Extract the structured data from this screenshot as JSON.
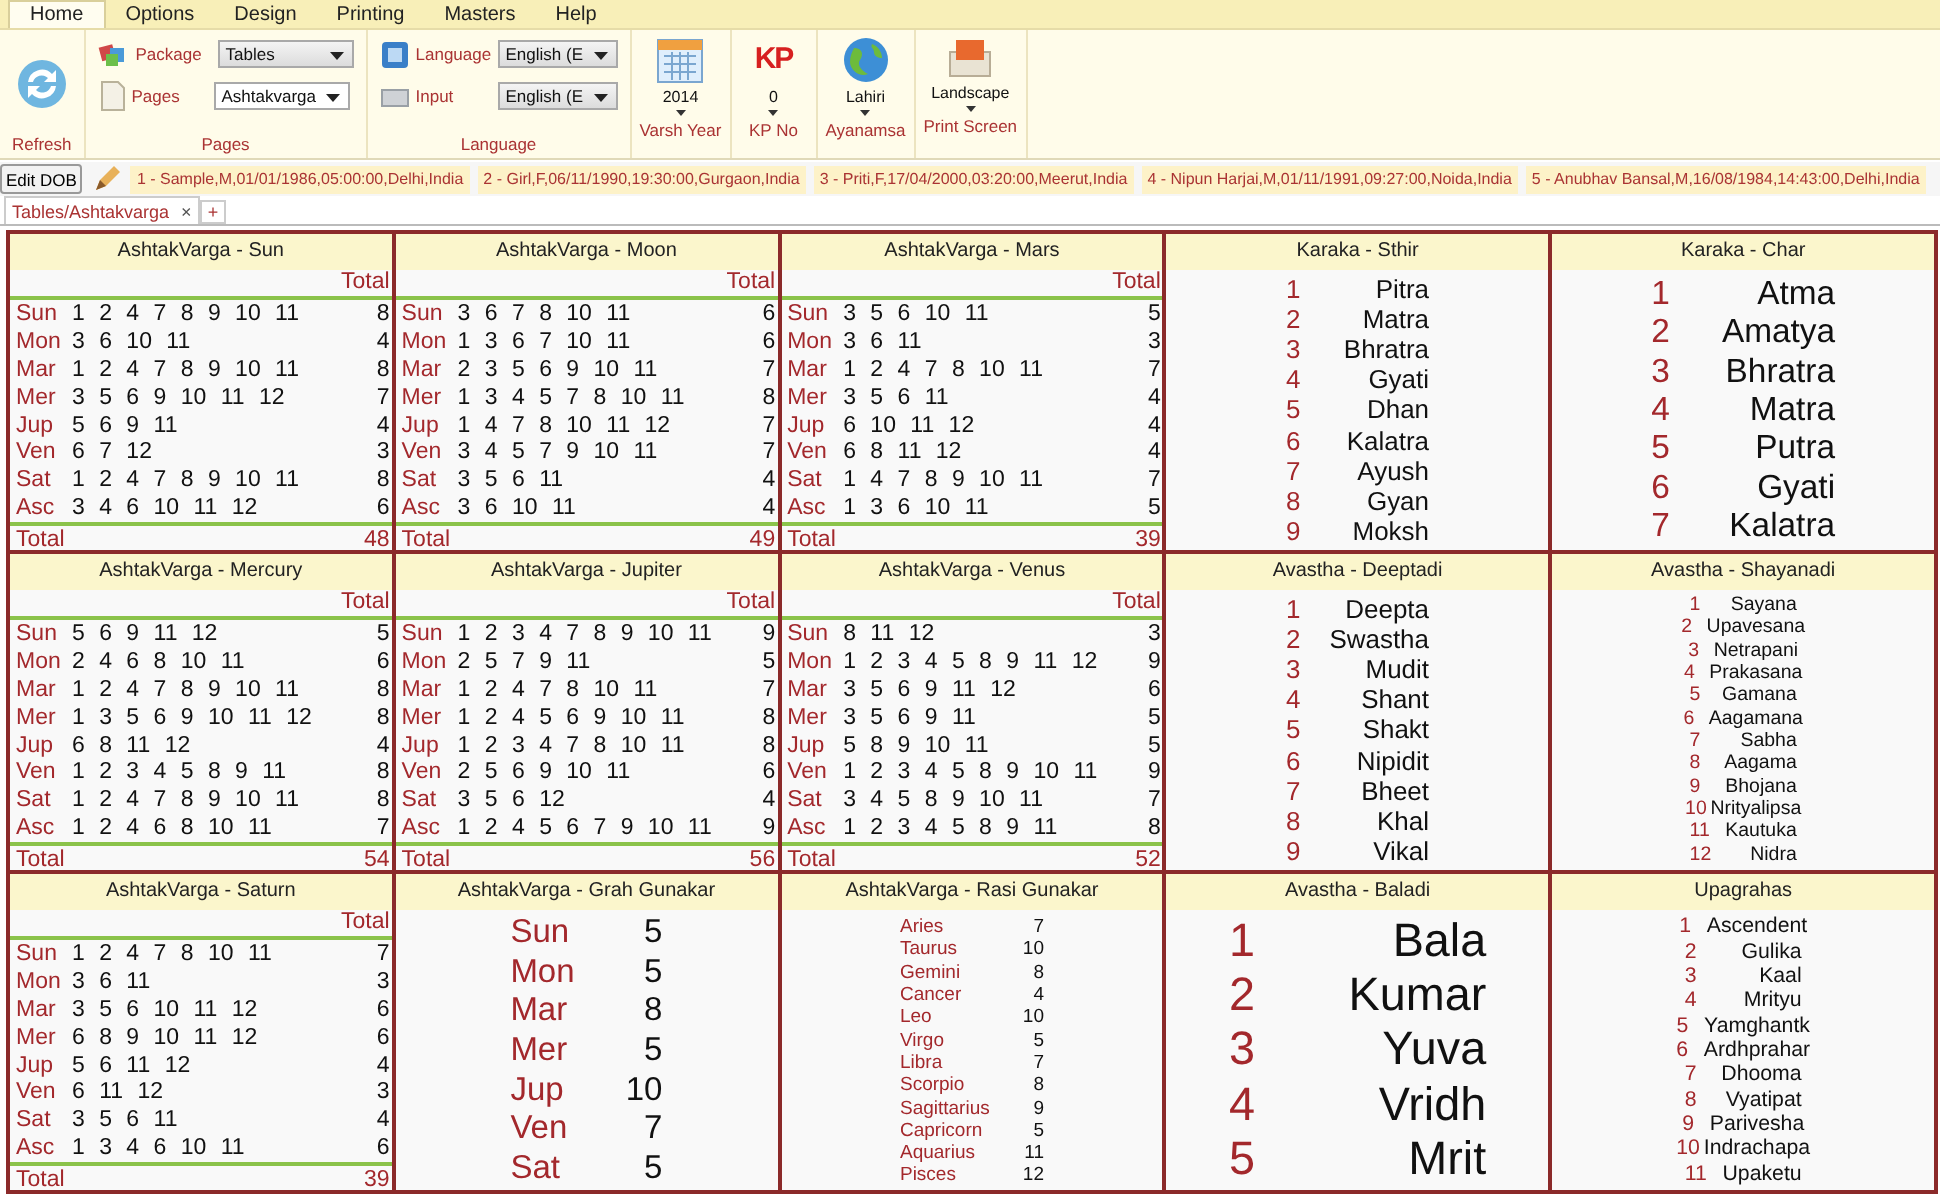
{
  "ribbon": {
    "tabs": [
      {
        "label": "Home",
        "selected": true
      },
      {
        "label": "Options",
        "selected": false
      },
      {
        "label": "Design",
        "selected": false
      },
      {
        "label": "Printing",
        "selected": false
      },
      {
        "label": "Masters",
        "selected": false
      },
      {
        "label": "Help",
        "selected": false
      }
    ],
    "refresh": {
      "label": "Refresh"
    },
    "pages_group": {
      "label": "Pages",
      "package_label": "Package",
      "package_value": "Tables",
      "pages_label": "Pages",
      "pages_value": "Ashtakvarga"
    },
    "language_group": {
      "label": "Language",
      "language_label": "Language",
      "language_value": "English (E",
      "input_label": "Input",
      "input_value": "English (E"
    },
    "tools": [
      {
        "kind": "calendar",
        "value": "2014",
        "label": "Varsh Year"
      },
      {
        "kind": "kp",
        "icon_text": "KP",
        "value": "0",
        "label": "KP No"
      },
      {
        "kind": "globe",
        "value": "Lahiri",
        "label": "Ayanamsa"
      },
      {
        "kind": "print",
        "value": "Landscape",
        "label": "Print Screen"
      }
    ]
  },
  "dob_bar": {
    "button": "Edit DOB",
    "persons": [
      "1 - Sample,M,01/01/1986,05:00:00,Delhi,India",
      "2 - Girl,F,06/11/1990,19:30:00,Gurgaon,India",
      "3 - Priti,F,17/04/2000,03:20:00,Meerut,India",
      "4 - Nipun Harjai,M,01/11/1991,09:27:00,Noida,India",
      "5 - Anubhav Bansal,M,16/08/1984,14:43:00,Delhi,India"
    ]
  },
  "doc_tabs": [
    {
      "label": "Tables/Ashtakvarga",
      "close": "×",
      "selected": true
    }
  ],
  "add_tab": "+",
  "panels": [
    {
      "kind": "ashtakvarga",
      "title": "AshtakVarga - Sun",
      "total_heading": "Total",
      "footer_label": "Total",
      "footer_total": "48",
      "rows": [
        {
          "planet": "Sun",
          "points": "1 2 4 7 8 9 10 11",
          "total": "8"
        },
        {
          "planet": "Mon",
          "points": "3 6 10 11",
          "total": "4"
        },
        {
          "planet": "Mar",
          "points": "1 2 4 7 8 9 10 11",
          "total": "8"
        },
        {
          "planet": "Mer",
          "points": "3 5 6 9 10 11 12",
          "total": "7"
        },
        {
          "planet": "Jup",
          "points": "5 6 9 11",
          "total": "4"
        },
        {
          "planet": "Ven",
          "points": "6 7 12",
          "total": "3"
        },
        {
          "planet": "Sat",
          "points": "1 2 4 7 8 9 10 11",
          "total": "8"
        },
        {
          "planet": "Asc",
          "points": "3 4 6 10 11 12",
          "total": "6"
        }
      ]
    },
    {
      "kind": "ashtakvarga",
      "title": "AshtakVarga - Moon",
      "total_heading": "Total",
      "footer_label": "Total",
      "footer_total": "49",
      "rows": [
        {
          "planet": "Sun",
          "points": "3 6 7 8 10 11",
          "total": "6"
        },
        {
          "planet": "Mon",
          "points": "1 3 6 7 10 11",
          "total": "6"
        },
        {
          "planet": "Mar",
          "points": "2 3 5 6 9 10 11",
          "total": "7"
        },
        {
          "planet": "Mer",
          "points": "1 3 4 5 7 8 10 11",
          "total": "8"
        },
        {
          "planet": "Jup",
          "points": "1 4 7 8 10 11 12",
          "total": "7"
        },
        {
          "planet": "Ven",
          "points": "3 4 5 7 9 10 11",
          "total": "7"
        },
        {
          "planet": "Sat",
          "points": "3 5 6 11",
          "total": "4"
        },
        {
          "planet": "Asc",
          "points": "3 6 10 11",
          "total": "4"
        }
      ]
    },
    {
      "kind": "ashtakvarga",
      "title": "AshtakVarga - Mars",
      "total_heading": "Total",
      "footer_label": "Total",
      "footer_total": "39",
      "rows": [
        {
          "planet": "Sun",
          "points": "3 5 6 10 11",
          "total": "5"
        },
        {
          "planet": "Mon",
          "points": "3 6 11",
          "total": "3"
        },
        {
          "planet": "Mar",
          "points": "1 2 4 7 8 10 11",
          "total": "7"
        },
        {
          "planet": "Mer",
          "points": "3 5 6 11",
          "total": "4"
        },
        {
          "planet": "Jup",
          "points": "6 10 11 12",
          "total": "4"
        },
        {
          "planet": "Ven",
          "points": "6 8 11 12",
          "total": "4"
        },
        {
          "planet": "Sat",
          "points": "1 4 7 8 9 10 11",
          "total": "7"
        },
        {
          "planet": "Asc",
          "points": "1 3 6 10 11",
          "total": "5"
        }
      ]
    },
    {
      "kind": "numbered",
      "title": "Karaka - Sthir",
      "items": [
        {
          "number": "1",
          "name": "Pitra"
        },
        {
          "number": "2",
          "name": "Matra"
        },
        {
          "number": "3",
          "name": "Bhratra"
        },
        {
          "number": "4",
          "name": "Gyati"
        },
        {
          "number": "5",
          "name": "Dhan"
        },
        {
          "number": "6",
          "name": "Kalatra"
        },
        {
          "number": "7",
          "name": "Ayush"
        },
        {
          "number": "8",
          "name": "Gyan"
        },
        {
          "number": "9",
          "name": "Moksh"
        }
      ]
    },
    {
      "kind": "numbered",
      "title": "Karaka - Char",
      "items": [
        {
          "number": "1",
          "name": "Atma"
        },
        {
          "number": "2",
          "name": "Amatya"
        },
        {
          "number": "3",
          "name": "Bhratra"
        },
        {
          "number": "4",
          "name": "Matra"
        },
        {
          "number": "5",
          "name": "Putra"
        },
        {
          "number": "6",
          "name": "Gyati"
        },
        {
          "number": "7",
          "name": "Kalatra"
        }
      ]
    },
    {
      "kind": "ashtakvarga",
      "title": "AshtakVarga - Mercury",
      "total_heading": "Total",
      "footer_label": "Total",
      "footer_total": "54",
      "rows": [
        {
          "planet": "Sun",
          "points": "5 6 9 11 12",
          "total": "5"
        },
        {
          "planet": "Mon",
          "points": "2 4 6 8 10 11",
          "total": "6"
        },
        {
          "planet": "Mar",
          "points": "1 2 4 7 8 9 10 11",
          "total": "8"
        },
        {
          "planet": "Mer",
          "points": "1 3 5 6 9 10 11 12",
          "total": "8"
        },
        {
          "planet": "Jup",
          "points": "6 8 11 12",
          "total": "4"
        },
        {
          "planet": "Ven",
          "points": "1 2 3 4 5 8 9 11",
          "total": "8"
        },
        {
          "planet": "Sat",
          "points": "1 2 4 7 8 9 10 11",
          "total": "8"
        },
        {
          "planet": "Asc",
          "points": "1 2 4 6 8 10 11",
          "total": "7"
        }
      ]
    },
    {
      "kind": "ashtakvarga",
      "title": "AshtakVarga - Jupiter",
      "total_heading": "Total",
      "footer_label": "Total",
      "footer_total": "56",
      "rows": [
        {
          "planet": "Sun",
          "points": "1 2 3 4 7 8 9 10 11",
          "total": "9"
        },
        {
          "planet": "Mon",
          "points": "2 5 7 9 11",
          "total": "5"
        },
        {
          "planet": "Mar",
          "points": "1 2 4 7 8 10 11",
          "total": "7"
        },
        {
          "planet": "Mer",
          "points": "1 2 4 5 6 9 10 11",
          "total": "8"
        },
        {
          "planet": "Jup",
          "points": "1 2 3 4 7 8 10 11",
          "total": "8"
        },
        {
          "planet": "Ven",
          "points": "2 5 6 9 10 11",
          "total": "6"
        },
        {
          "planet": "Sat",
          "points": "3 5 6 12",
          "total": "4"
        },
        {
          "planet": "Asc",
          "points": "1 2 4 5 6 7 9 10 11",
          "total": "9"
        }
      ]
    },
    {
      "kind": "ashtakvarga",
      "title": "AshtakVarga - Venus",
      "total_heading": "Total",
      "footer_label": "Total",
      "footer_total": "52",
      "rows": [
        {
          "planet": "Sun",
          "points": "8 11 12",
          "total": "3"
        },
        {
          "planet": "Mon",
          "points": "1 2 3 4 5 8 9 11 12",
          "total": "9"
        },
        {
          "planet": "Mar",
          "points": "3 5 6 9 11 12",
          "total": "6"
        },
        {
          "planet": "Mer",
          "points": "3 5 6 9 11",
          "total": "5"
        },
        {
          "planet": "Jup",
          "points": "5 8 9 10 11",
          "total": "5"
        },
        {
          "planet": "Ven",
          "points": "1 2 3 4 5 8 9 10 11",
          "total": "9"
        },
        {
          "planet": "Sat",
          "points": "3 4 5 8 9 10 11",
          "total": "7"
        },
        {
          "planet": "Asc",
          "points": "1 2 3 4 5 8 9 11",
          "total": "8"
        }
      ]
    },
    {
      "kind": "numbered",
      "title": "Avastha - Deeptadi",
      "items": [
        {
          "number": "1",
          "name": "Deepta"
        },
        {
          "number": "2",
          "name": "Swastha"
        },
        {
          "number": "3",
          "name": "Mudit"
        },
        {
          "number": "4",
          "name": "Shant"
        },
        {
          "number": "5",
          "name": "Shakt"
        },
        {
          "number": "6",
          "name": "Nipidit"
        },
        {
          "number": "7",
          "name": "Bheet"
        },
        {
          "number": "8",
          "name": "Khal"
        },
        {
          "number": "9",
          "name": "Vikal"
        }
      ]
    },
    {
      "kind": "numbered",
      "title": "Avastha - Shayanadi",
      "items": [
        {
          "number": "1",
          "name": "Sayana"
        },
        {
          "number": "2",
          "name": "Upavesana"
        },
        {
          "number": "3",
          "name": "Netrapani"
        },
        {
          "number": "4",
          "name": "Prakasana"
        },
        {
          "number": "5",
          "name": "Gamana"
        },
        {
          "number": "6",
          "name": "Aagamana"
        },
        {
          "number": "7",
          "name": "Sabha"
        },
        {
          "number": "8",
          "name": "Aagama"
        },
        {
          "number": "9",
          "name": "Bhojana"
        },
        {
          "number": "10",
          "name": "Nrityalipsa"
        },
        {
          "number": "11",
          "name": "Kautuka"
        },
        {
          "number": "12",
          "name": "Nidra"
        }
      ]
    },
    {
      "kind": "ashtakvarga",
      "title": "AshtakVarga - Saturn",
      "total_heading": "Total",
      "footer_label": "Total",
      "footer_total": "39",
      "rows": [
        {
          "planet": "Sun",
          "points": "1 2 4 7 8 10 11",
          "total": "7"
        },
        {
          "planet": "Mon",
          "points": "3 6 11",
          "total": "3"
        },
        {
          "planet": "Mar",
          "points": "3 5 6 10 11 12",
          "total": "6"
        },
        {
          "planet": "Mer",
          "points": "6 8 9 10 11 12",
          "total": "6"
        },
        {
          "planet": "Jup",
          "points": "5 6 11 12",
          "total": "4"
        },
        {
          "planet": "Ven",
          "points": "6 11 12",
          "total": "3"
        },
        {
          "planet": "Sat",
          "points": "3 5 6 11",
          "total": "4"
        },
        {
          "planet": "Asc",
          "points": "1 3 4 6 10 11",
          "total": "6"
        }
      ]
    },
    {
      "kind": "grah",
      "title": "AshtakVarga - Grah Gunakar",
      "rows": [
        {
          "name": "Sun",
          "value": "5"
        },
        {
          "name": "Mon",
          "value": "5"
        },
        {
          "name": "Mar",
          "value": "8"
        },
        {
          "name": "Mer",
          "value": "5"
        },
        {
          "name": "Jup",
          "value": "10"
        },
        {
          "name": "Ven",
          "value": "7"
        },
        {
          "name": "Sat",
          "value": "5"
        }
      ]
    },
    {
      "kind": "rasi",
      "title": "AshtakVarga - Rasi Gunakar",
      "rows": [
        {
          "name": "Aries",
          "value": "7"
        },
        {
          "name": "Taurus",
          "value": "10"
        },
        {
          "name": "Gemini",
          "value": "8"
        },
        {
          "name": "Cancer",
          "value": "4"
        },
        {
          "name": "Leo",
          "value": "10"
        },
        {
          "name": "Virgo",
          "value": "5"
        },
        {
          "name": "Libra",
          "value": "7"
        },
        {
          "name": "Scorpio",
          "value": "8"
        },
        {
          "name": "Sagittarius",
          "value": "9"
        },
        {
          "name": "Capricorn",
          "value": "5"
        },
        {
          "name": "Aquarius",
          "value": "11"
        },
        {
          "name": "Pisces",
          "value": "12"
        }
      ]
    },
    {
      "kind": "numbered",
      "title": "Avastha - Baladi",
      "items": [
        {
          "number": "1",
          "name": "Bala"
        },
        {
          "number": "2",
          "name": "Kumar"
        },
        {
          "number": "3",
          "name": "Yuva"
        },
        {
          "number": "4",
          "name": "Vridh"
        },
        {
          "number": "5",
          "name": "Mrit"
        }
      ]
    },
    {
      "kind": "numbered",
      "title": "Upagrahas",
      "items": [
        {
          "number": "1",
          "name": "Ascendent"
        },
        {
          "number": "2",
          "name": "Gulika"
        },
        {
          "number": "3",
          "name": "Kaal"
        },
        {
          "number": "4",
          "name": "Mrityu"
        },
        {
          "number": "5",
          "name": "Yamghantk"
        },
        {
          "number": "6",
          "name": "Ardhprahar"
        },
        {
          "number": "7",
          "name": "Dhooma"
        },
        {
          "number": "8",
          "name": "Vyatipat"
        },
        {
          "number": "9",
          "name": "Parivesha"
        },
        {
          "number": "10",
          "name": "Indrachapa"
        },
        {
          "number": "11",
          "name": "Upaketu"
        }
      ]
    }
  ]
}
